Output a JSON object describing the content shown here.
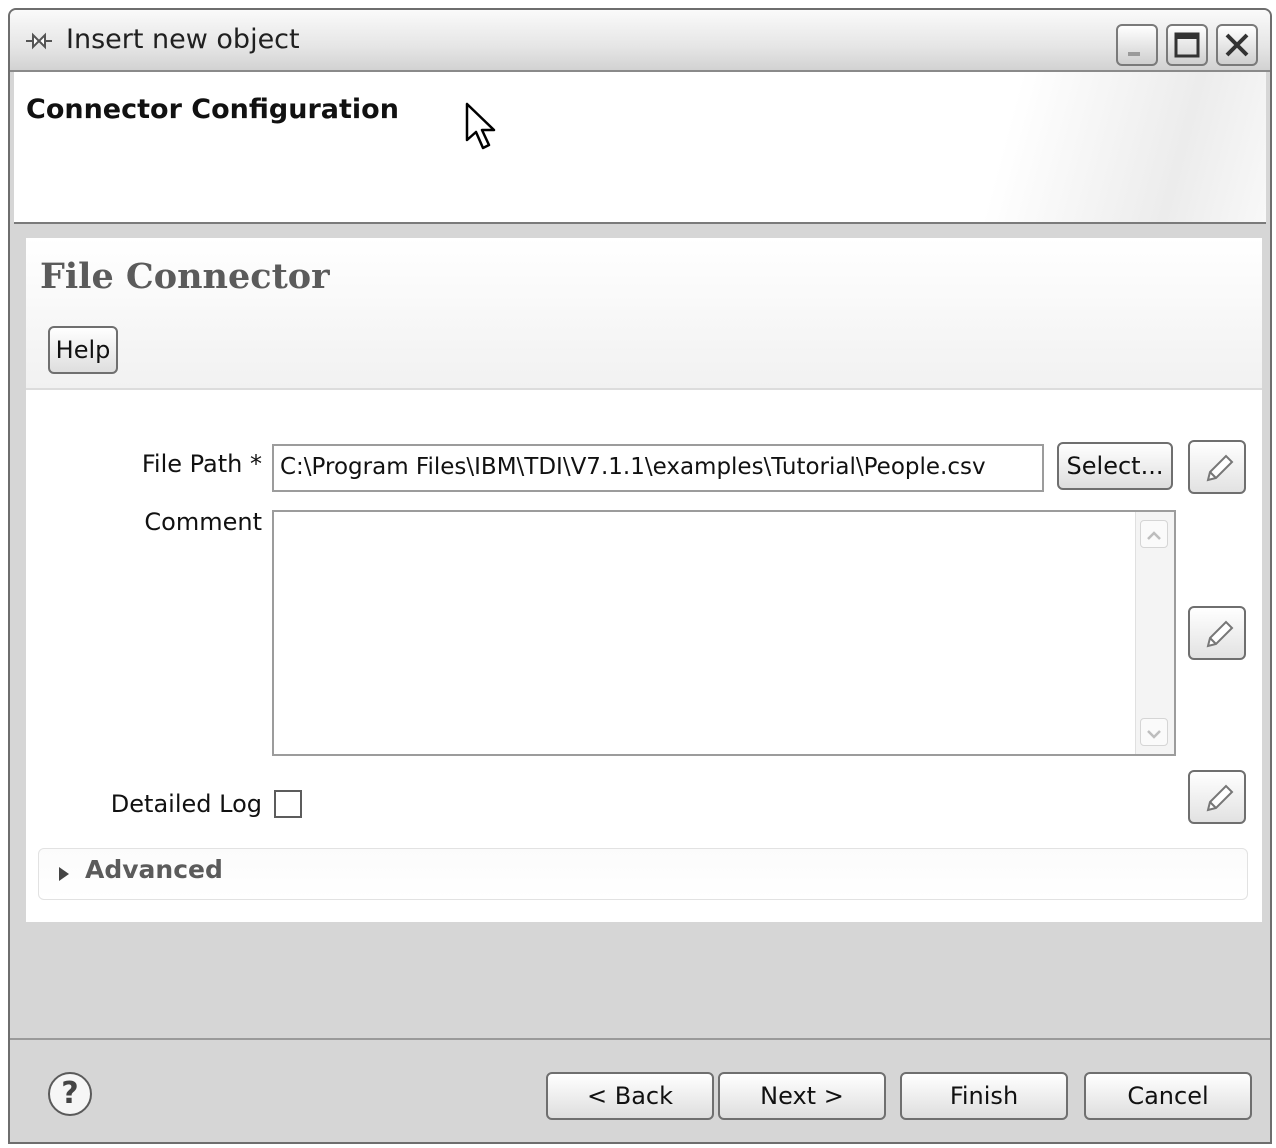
{
  "window": {
    "title": "Insert new object",
    "controls": {
      "minimize_icon": "minimize-icon",
      "maximize_icon": "maximize-icon",
      "close_icon": "close-icon"
    }
  },
  "header": {
    "title": "Connector Configuration"
  },
  "form": {
    "title": "File Connector",
    "help_button": "Help",
    "file_path": {
      "label": "File Path *",
      "value": "C:\\Program Files\\IBM\\TDI\\V7.1.1\\examples\\Tutorial\\People.csv",
      "select_button": "Select..."
    },
    "comment": {
      "label": "Comment",
      "value": ""
    },
    "detailed_log": {
      "label": "Detailed Log",
      "checked": false
    },
    "advanced": {
      "label": "Advanced",
      "expanded": false
    }
  },
  "footer": {
    "help_icon": "?",
    "back": "< Back",
    "next": "Next >",
    "finish": "Finish",
    "cancel": "Cancel"
  }
}
